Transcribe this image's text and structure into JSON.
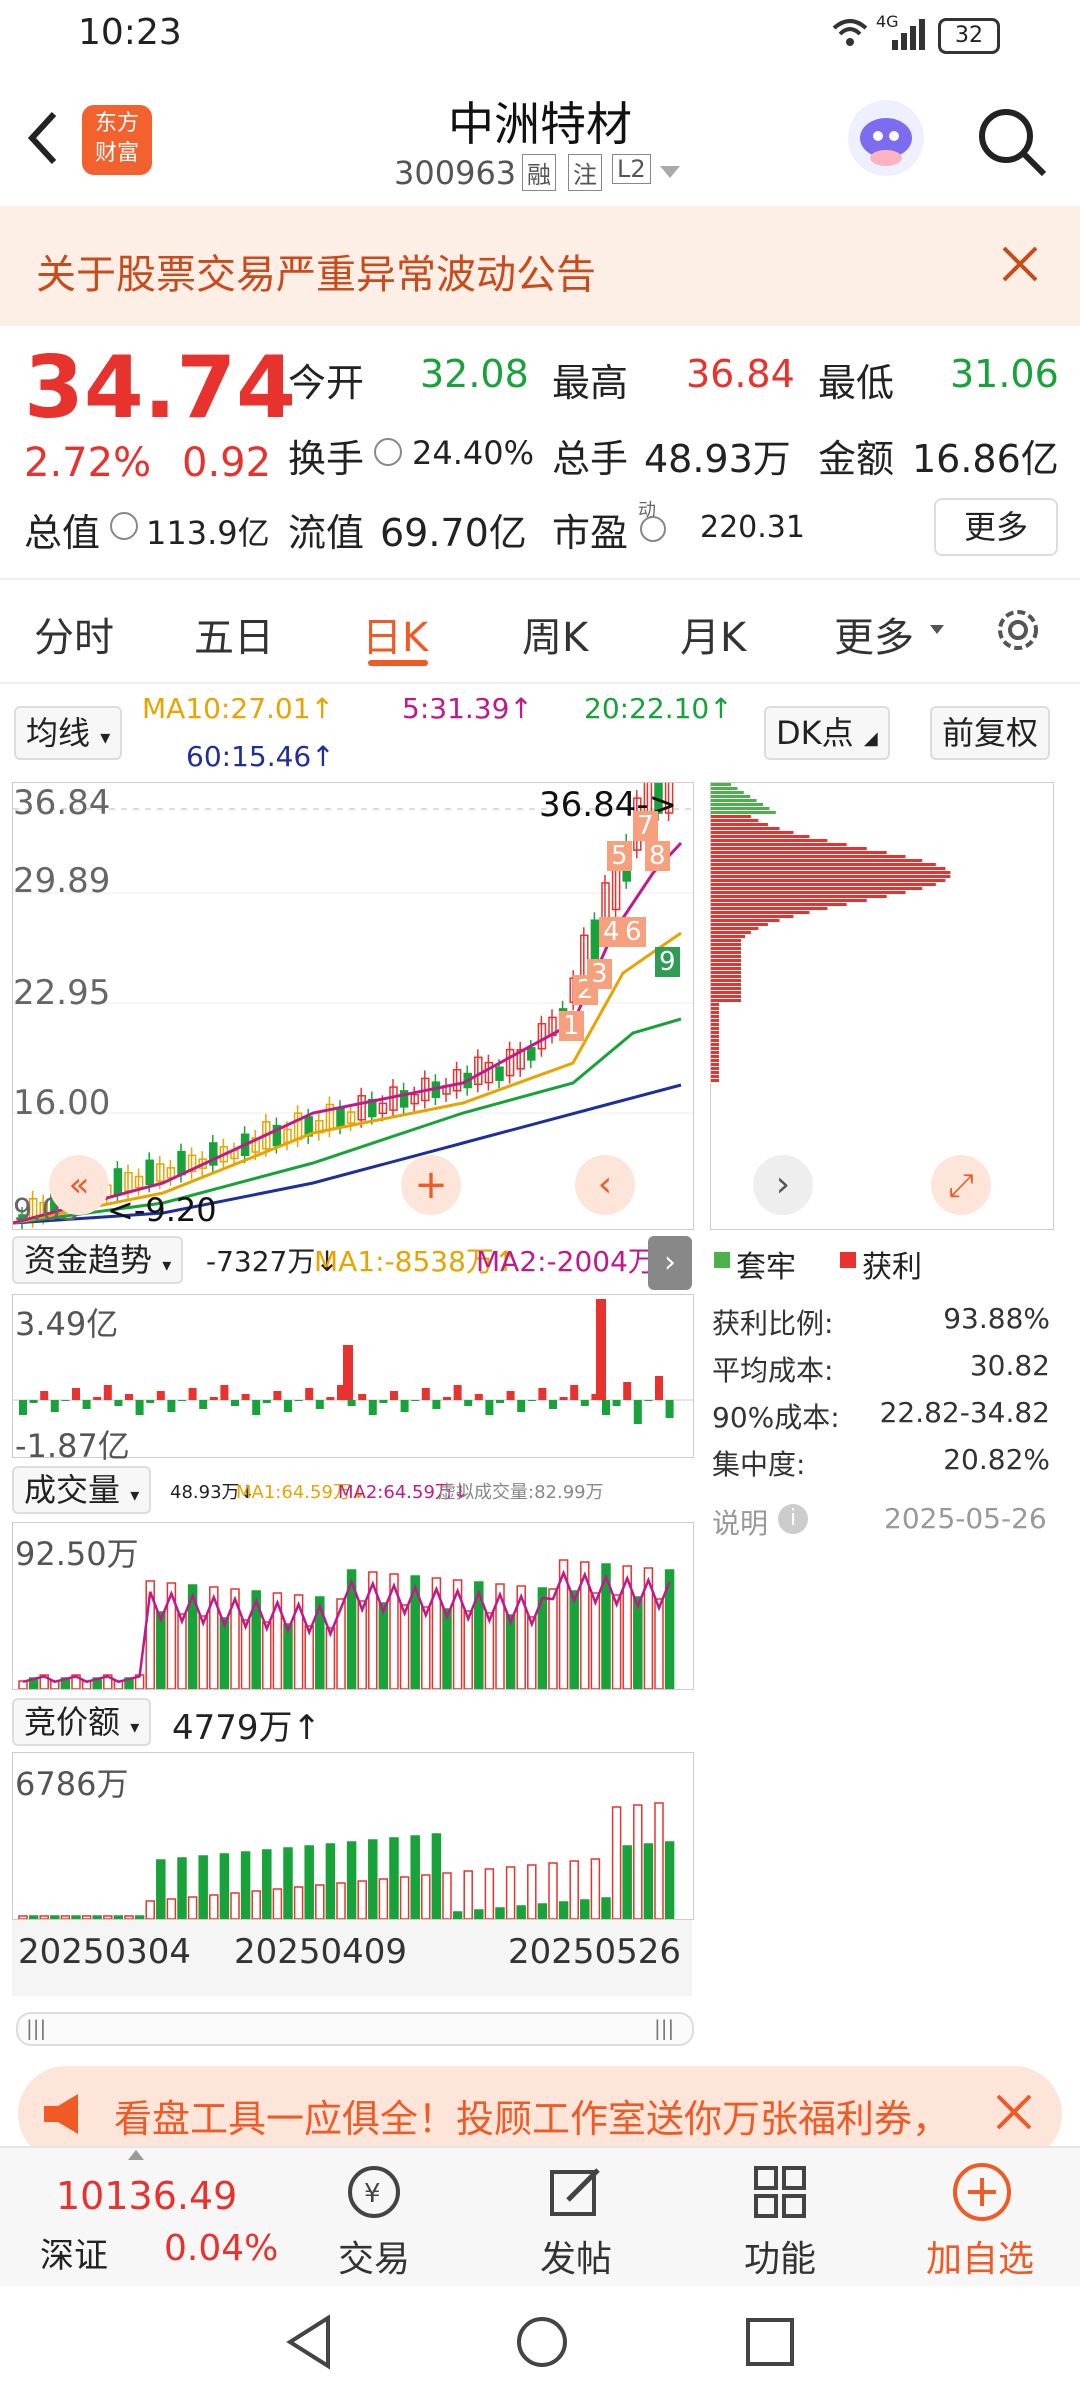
{
  "status": {
    "time": "10:23",
    "battery": "32",
    "network": "4G"
  },
  "header": {
    "logo_text": "东方\n财富",
    "title": "中洲特材",
    "code": "300963",
    "badges": [
      "融",
      "注",
      "L2"
    ]
  },
  "notice": {
    "text": "关于股票交易严重异常波动公告"
  },
  "quote": {
    "price": "34.74",
    "pct": "2.72%",
    "change": "0.92",
    "open_label": "今开",
    "open": "32.08",
    "high_label": "最高",
    "high": "36.84",
    "low_label": "最低",
    "low": "31.06",
    "turnover_label": "换手",
    "turnover": "24.40%",
    "volume_label": "总手",
    "volume": "48.93万",
    "amount_label": "金额",
    "amount": "16.86亿",
    "mktcap_label": "总值",
    "mktcap": "113.9亿",
    "float_label": "流值",
    "float": "69.70亿",
    "pe_label": "市盈",
    "pe_sup": "动",
    "pe": "220.31",
    "more": "更多"
  },
  "tabs": [
    "分时",
    "五日",
    "日K",
    "周K",
    "月K",
    "更多"
  ],
  "ma_row": {
    "selector": "均线",
    "ma10": "MA10:27.01↑",
    "ma5": "5:31.39↑",
    "ma20": "20:22.10↑",
    "ma60": "60:15.46↑",
    "dk": "DK点",
    "fq": "前复权"
  },
  "kchart": {
    "y_labels": [
      "36.84",
      "29.89",
      "22.95",
      "16.00",
      "9.05"
    ],
    "high_marker": "36.84->",
    "low_marker": "<-9.20",
    "seq_labels": [
      "1",
      "2",
      "3",
      "4",
      "5",
      "6",
      "7",
      "8",
      "9"
    ]
  },
  "fund": {
    "selector": "资金趋势",
    "value": "-7327万↓",
    "ma1": "MA1:-8538万↑",
    "ma2": "MA2:-2004万↓",
    "y_top": "3.49亿",
    "y_bottom": "-1.87亿"
  },
  "vol": {
    "selector": "成交量",
    "value": "48.93万↓",
    "ma1": "MA1:64.59万↓",
    "ma2": "MA2:64.59万↓",
    "virtual": "虚拟成交量:82.99万",
    "y_top": "92.50万"
  },
  "auction": {
    "selector": "竞价额",
    "value": "4779万↑",
    "y_top": "6786万"
  },
  "dates": [
    "20250304",
    "20250409",
    "20250526"
  ],
  "chip": {
    "legend_trap": "套牢",
    "legend_profit": "获利",
    "rows": [
      {
        "k": "获利比例:",
        "v": "93.88%"
      },
      {
        "k": "平均成本:",
        "v": "30.82"
      },
      {
        "k": "90%成本:",
        "v": "22.82-34.82"
      },
      {
        "k": "集中度:",
        "v": "20.82%"
      }
    ],
    "note": "说明",
    "date": "2025-05-26"
  },
  "promo": {
    "text": "看盘工具一应俱全！投顾工作室送你万张福利券，"
  },
  "bottom": {
    "index_value": "10136.49",
    "index_name": "深证",
    "index_pct": "0.04%",
    "nav": [
      "交易",
      "发帖",
      "功能",
      "加自选"
    ]
  },
  "colors": {
    "up": "#e8322d",
    "down": "#18a33a",
    "accent": "#ef5a25"
  }
}
